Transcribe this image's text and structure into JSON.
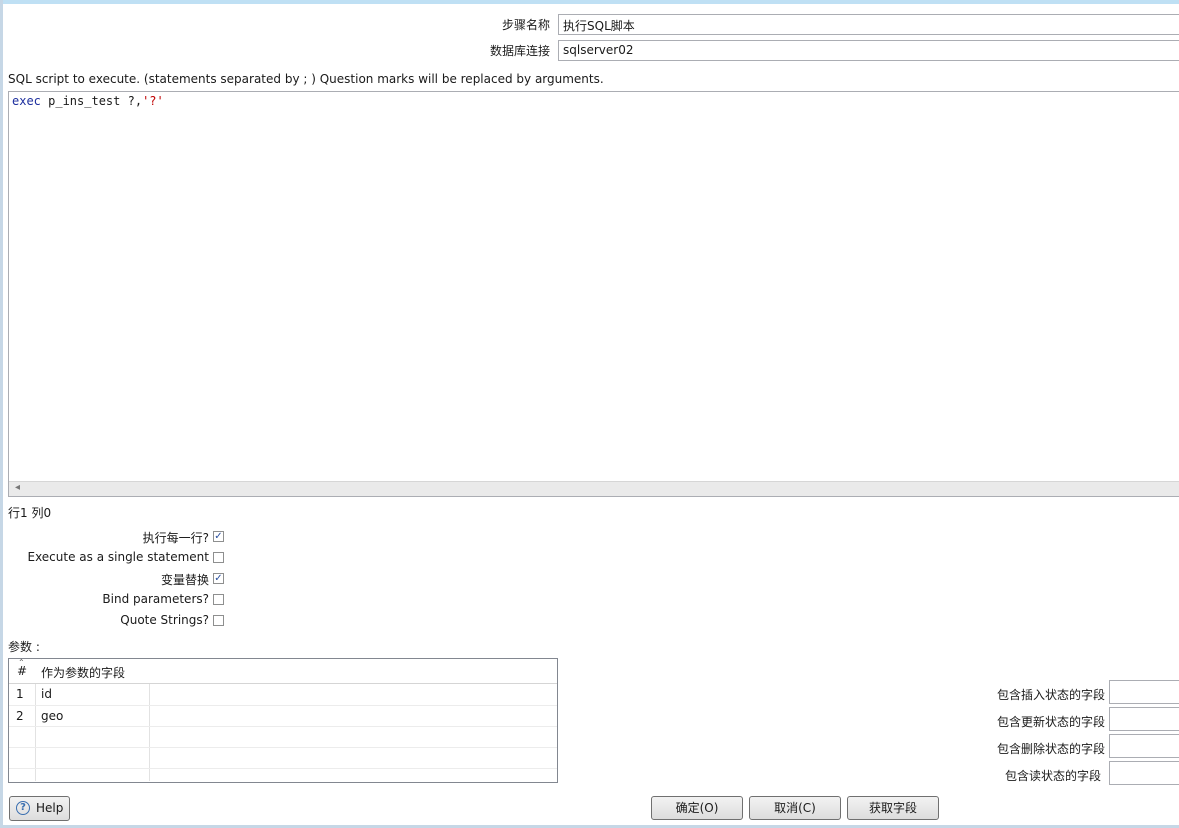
{
  "form": {
    "step_name_label": "步骤名称",
    "step_name_value": "执行SQL脚本",
    "db_conn_label": "数据库连接",
    "db_conn_value": "sqlserver02"
  },
  "sql": {
    "hint": "SQL script to execute. (statements separated by ; ) Question marks will be replaced by arguments.",
    "code_keyword": "exec",
    "code_rest": " p_ins_test ?,",
    "code_string": "'?'",
    "cursor_position": "行1 列0"
  },
  "options": [
    {
      "label": "执行每一行?",
      "checked": true
    },
    {
      "label": "Execute as a single statement",
      "checked": false
    },
    {
      "label": "变量替换",
      "checked": true
    },
    {
      "label": "Bind parameters?",
      "checked": false
    },
    {
      "label": "Quote Strings?",
      "checked": false
    }
  ],
  "params": {
    "label": "参数 :",
    "col_num": "#",
    "col_field": "作为参数的字段",
    "rows": [
      {
        "num": "1",
        "field": "id"
      },
      {
        "num": "2",
        "field": "geo"
      }
    ]
  },
  "status_fields": {
    "insert_label": "包含插入状态的字段",
    "update_label": "包含更新状态的字段",
    "delete_label": "包含删除状态的字段",
    "read_label": "包含读状态的字段"
  },
  "buttons": {
    "help": "Help",
    "ok": "确定(O)",
    "cancel": "取消(C)",
    "get_fields": "获取字段"
  }
}
